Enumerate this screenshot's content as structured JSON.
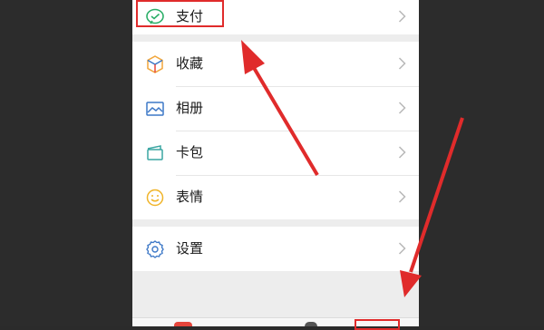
{
  "menu": {
    "top": {
      "label": "支付",
      "icon": "wechat-pay-icon"
    },
    "items": [
      {
        "label": "收藏",
        "icon": "favorites-cube-icon"
      },
      {
        "label": "相册",
        "icon": "photo-album-icon"
      },
      {
        "label": "卡包",
        "icon": "card-wallet-icon"
      },
      {
        "label": "表情",
        "icon": "emoji-face-icon"
      }
    ],
    "settings": {
      "label": "设置",
      "icon": "gear-icon"
    }
  },
  "annotations": {
    "color": "#e02b2b",
    "highlights": [
      "pay-row-highlight",
      "tab-me-highlight"
    ]
  },
  "colors": {
    "pay_green": "#2aae67",
    "favorites_orange": "#f2a63b",
    "album_blue": "#3d78c7",
    "card_teal": "#3aa6a2",
    "emoji_yellow": "#f0b429",
    "settings_blue": "#3d78c7"
  }
}
